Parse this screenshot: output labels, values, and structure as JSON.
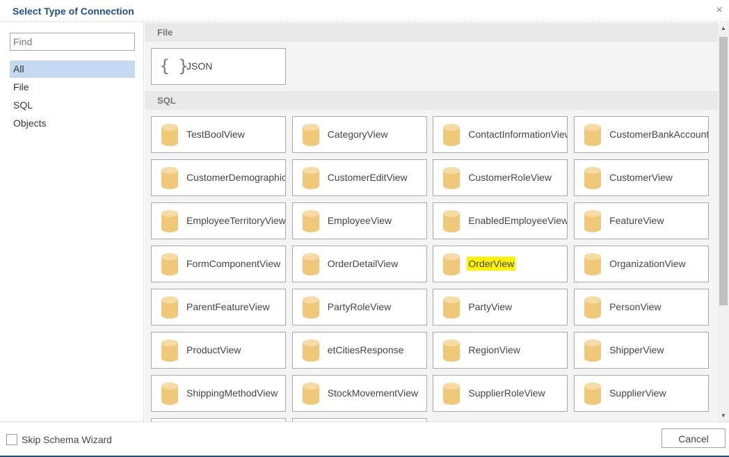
{
  "dialog": {
    "title": "Select Type of Connection",
    "close_glyph": "×"
  },
  "search": {
    "placeholder": "Find",
    "value": ""
  },
  "categories": [
    {
      "label": "All",
      "selected": true
    },
    {
      "label": "File",
      "selected": false
    },
    {
      "label": "SQL",
      "selected": false
    },
    {
      "label": "Objects",
      "selected": false
    }
  ],
  "sections": {
    "file": {
      "header": "File",
      "items": [
        {
          "label": "JSON",
          "icon": "json-braces-icon"
        }
      ]
    },
    "sql": {
      "header": "SQL",
      "items": [
        {
          "label": "TestBoolView",
          "icon": "database-icon"
        },
        {
          "label": "CategoryView",
          "icon": "database-icon"
        },
        {
          "label": "ContactInformationView",
          "icon": "database-icon"
        },
        {
          "label": "CustomerBankAccountView",
          "icon": "database-icon"
        },
        {
          "label": "CustomerDemographicView",
          "icon": "database-icon"
        },
        {
          "label": "CustomerEditView",
          "icon": "database-icon"
        },
        {
          "label": "CustomerRoleView",
          "icon": "database-icon"
        },
        {
          "label": "CustomerView",
          "icon": "database-icon"
        },
        {
          "label": "EmployeeTerritoryView",
          "icon": "database-icon"
        },
        {
          "label": "EmployeeView",
          "icon": "database-icon"
        },
        {
          "label": "EnabledEmployeeView",
          "icon": "database-icon"
        },
        {
          "label": "FeatureView",
          "icon": "database-icon"
        },
        {
          "label": "FormComponentView",
          "icon": "database-icon"
        },
        {
          "label": "OrderDetailView",
          "icon": "database-icon"
        },
        {
          "label": "OrderView",
          "icon": "database-icon",
          "highlighted": true
        },
        {
          "label": "OrganizationView",
          "icon": "database-icon"
        },
        {
          "label": "ParentFeatureView",
          "icon": "database-icon"
        },
        {
          "label": "PartyRoleView",
          "icon": "database-icon"
        },
        {
          "label": "PartyView",
          "icon": "database-icon"
        },
        {
          "label": "PersonView",
          "icon": "database-icon"
        },
        {
          "label": "ProductView",
          "icon": "database-icon"
        },
        {
          "label": "etCitiesResponse",
          "icon": "database-icon"
        },
        {
          "label": "RegionView",
          "icon": "database-icon"
        },
        {
          "label": "ShipperView",
          "icon": "database-icon"
        },
        {
          "label": "ShippingMethodView",
          "icon": "database-icon"
        },
        {
          "label": "StockMovementView",
          "icon": "database-icon"
        },
        {
          "label": "SupplierRoleView",
          "icon": "database-icon"
        },
        {
          "label": "SupplierView",
          "icon": "database-icon"
        }
      ]
    }
  },
  "footer": {
    "skip_label": "Skip Schema Wizard",
    "skip_checked": false,
    "cancel_label": "Cancel"
  },
  "colors": {
    "title": "#1f4e8c",
    "selected_category": "#c5d9f1",
    "database_icon": "#f0c87a",
    "highlight": "#fff200"
  }
}
